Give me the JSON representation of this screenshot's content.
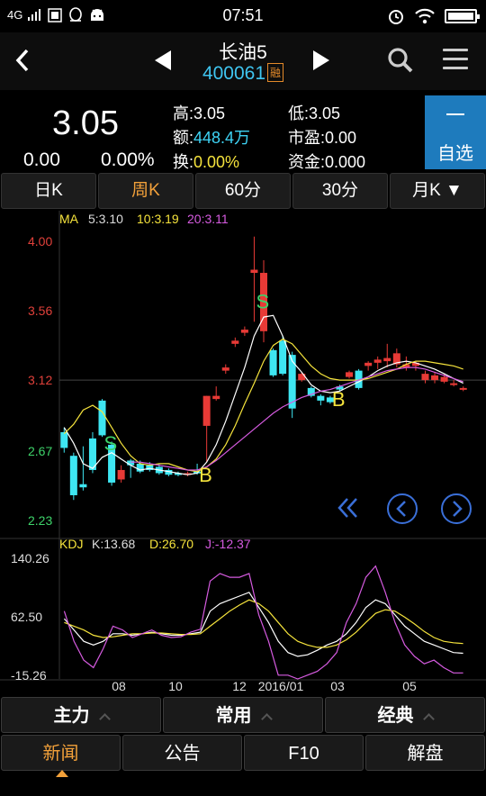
{
  "status_bar": {
    "network": "4G",
    "time": "07:51"
  },
  "header": {
    "stock_name": "长油5",
    "stock_code": "400061",
    "margin_badge": "融"
  },
  "quote": {
    "price": "3.05",
    "change": "0.00",
    "change_pct": "0.00%",
    "high_label": "高:",
    "high_value": "3.05",
    "amount_label": "额:",
    "amount_value": "448.4万",
    "turnover_label": "换:",
    "turnover_value": "0.00%",
    "low_label": "低:",
    "low_value": "3.05",
    "pe_label": "市盈:",
    "pe_value": "0.00",
    "fund_label": "资金:",
    "fund_value": "0.000",
    "favorite_label": "自选"
  },
  "period_tabs": [
    "日K",
    "周K",
    "60分",
    "30分",
    "月K ▼"
  ],
  "active_tab": 1,
  "chart_data": [
    {
      "type": "candlestick",
      "title": "MA",
      "legend": [
        {
          "label": "5:3.10",
          "color": "#ffffff"
        },
        {
          "label": "10:3.19",
          "color": "#f5e33c"
        },
        {
          "label": "20:3.11",
          "color": "#d65be0"
        }
      ],
      "y_ticks": [
        "4.00",
        "3.56",
        "3.12",
        "2.67",
        "2.23"
      ],
      "ylim": [
        2.23,
        4.0
      ],
      "x_ticks": [
        "08",
        "10",
        "12",
        "2016/01",
        "03",
        "05"
      ],
      "annotations": [
        "S",
        "B",
        "S",
        "B",
        "B"
      ],
      "candles": [
        {
          "o": 2.79,
          "c": 2.69,
          "h": 2.82,
          "l": 2.66,
          "up": false
        },
        {
          "o": 2.64,
          "c": 2.39,
          "h": 2.66,
          "l": 2.36,
          "up": false
        },
        {
          "o": 2.46,
          "c": 2.44,
          "h": 2.7,
          "l": 2.42,
          "up": false
        },
        {
          "o": 2.75,
          "c": 2.55,
          "h": 2.79,
          "l": 2.53,
          "up": false
        },
        {
          "o": 2.99,
          "c": 2.77,
          "h": 3.0,
          "l": 2.76,
          "up": false
        },
        {
          "o": 2.71,
          "c": 2.47,
          "h": 2.73,
          "l": 2.45,
          "up": false
        },
        {
          "o": 2.55,
          "c": 2.49,
          "h": 2.58,
          "l": 2.47,
          "up": true
        },
        {
          "o": 2.61,
          "c": 2.58,
          "h": 2.62,
          "l": 2.5,
          "up": false
        },
        {
          "o": 2.59,
          "c": 2.54,
          "h": 2.61,
          "l": 2.53,
          "up": false
        },
        {
          "o": 2.58,
          "c": 2.55,
          "h": 2.6,
          "l": 2.54,
          "up": false
        },
        {
          "o": 2.57,
          "c": 2.53,
          "h": 2.59,
          "l": 2.52,
          "up": false
        },
        {
          "o": 2.55,
          "c": 2.52,
          "h": 2.56,
          "l": 2.51,
          "up": false
        },
        {
          "o": 2.53,
          "c": 2.52,
          "h": 2.54,
          "l": 2.51,
          "up": false
        },
        {
          "o": 2.52,
          "c": 2.53,
          "h": 2.54,
          "l": 2.51,
          "up": true
        },
        {
          "o": 2.54,
          "c": 2.53,
          "h": 2.59,
          "l": 2.52,
          "up": false
        },
        {
          "o": 2.83,
          "c": 3.02,
          "h": 3.02,
          "l": 2.6,
          "up": true
        },
        {
          "o": 3.0,
          "c": 3.02,
          "h": 3.08,
          "l": 2.99,
          "up": true
        },
        {
          "o": 3.18,
          "c": 3.2,
          "h": 3.22,
          "l": 3.16,
          "up": true
        },
        {
          "o": 3.35,
          "c": 3.37,
          "h": 3.39,
          "l": 3.33,
          "up": true
        },
        {
          "o": 3.42,
          "c": 3.44,
          "h": 3.46,
          "l": 3.4,
          "up": true
        },
        {
          "o": 3.8,
          "c": 3.82,
          "h": 4.03,
          "l": 3.49,
          "up": true
        },
        {
          "o": 3.43,
          "c": 3.8,
          "h": 3.88,
          "l": 3.36,
          "up": true
        },
        {
          "o": 3.31,
          "c": 3.15,
          "h": 3.32,
          "l": 3.14,
          "up": false
        },
        {
          "o": 3.37,
          "c": 3.16,
          "h": 3.4,
          "l": 3.15,
          "up": false
        },
        {
          "o": 3.28,
          "c": 2.94,
          "h": 3.3,
          "l": 2.88,
          "up": false
        },
        {
          "o": 3.16,
          "c": 3.12,
          "h": 3.17,
          "l": 3.11,
          "up": true
        },
        {
          "o": 3.07,
          "c": 3.02,
          "h": 3.08,
          "l": 3.01,
          "up": false
        },
        {
          "o": 3.02,
          "c": 2.99,
          "h": 3.03,
          "l": 2.96,
          "up": false
        },
        {
          "o": 3.01,
          "c": 2.98,
          "h": 3.02,
          "l": 2.97,
          "up": false
        },
        {
          "o": 3.08,
          "c": 3.06,
          "h": 3.09,
          "l": 3.05,
          "up": false
        },
        {
          "o": 3.14,
          "c": 3.17,
          "h": 3.18,
          "l": 3.13,
          "up": true
        },
        {
          "o": 3.18,
          "c": 3.07,
          "h": 3.19,
          "l": 3.06,
          "up": false
        },
        {
          "o": 3.21,
          "c": 3.23,
          "h": 3.24,
          "l": 3.18,
          "up": true
        },
        {
          "o": 3.23,
          "c": 3.25,
          "h": 3.27,
          "l": 3.19,
          "up": true
        },
        {
          "o": 3.24,
          "c": 3.26,
          "h": 3.35,
          "l": 3.2,
          "up": true
        },
        {
          "o": 3.22,
          "c": 3.29,
          "h": 3.32,
          "l": 3.2,
          "up": true
        },
        {
          "o": 3.2,
          "c": 3.22,
          "h": 3.27,
          "l": 3.18,
          "up": true
        },
        {
          "o": 3.21,
          "c": 3.23,
          "h": 3.24,
          "l": 3.18,
          "up": true
        },
        {
          "o": 3.12,
          "c": 3.16,
          "h": 3.18,
          "l": 3.1,
          "up": true
        },
        {
          "o": 3.12,
          "c": 3.15,
          "h": 3.17,
          "l": 3.1,
          "up": true
        },
        {
          "o": 3.11,
          "c": 3.14,
          "h": 3.16,
          "l": 3.1,
          "up": true
        },
        {
          "o": 3.09,
          "c": 3.1,
          "h": 3.12,
          "l": 3.08,
          "up": true
        },
        {
          "o": 3.06,
          "c": 3.07,
          "h": 3.08,
          "l": 3.05,
          "up": true
        }
      ],
      "ma_series": [
        {
          "name": "MA5",
          "color": "#ffffff",
          "values": [
            2.82,
            2.72,
            2.59,
            2.56,
            2.63,
            2.66,
            2.62,
            2.58,
            2.55,
            2.56,
            2.55,
            2.54,
            2.53,
            2.52,
            2.53,
            2.6,
            2.71,
            2.86,
            3.03,
            3.2,
            3.4,
            3.52,
            3.53,
            3.4,
            3.24,
            3.17,
            3.09,
            3.05,
            3.04,
            3.05,
            3.08,
            3.11,
            3.14,
            3.18,
            3.21,
            3.23,
            3.24,
            3.23,
            3.21,
            3.19,
            3.16,
            3.13,
            3.1
          ]
        },
        {
          "name": "MA10",
          "color": "#f5e33c",
          "values": [
            2.78,
            2.84,
            2.93,
            2.96,
            2.92,
            2.82,
            2.72,
            2.64,
            2.59,
            2.58,
            2.59,
            2.59,
            2.57,
            2.55,
            2.54,
            2.57,
            2.62,
            2.71,
            2.83,
            2.97,
            3.1,
            3.24,
            3.34,
            3.38,
            3.35,
            3.28,
            3.21,
            3.16,
            3.13,
            3.12,
            3.12,
            3.12,
            3.13,
            3.15,
            3.17,
            3.19,
            3.22,
            3.24,
            3.24,
            3.23,
            3.22,
            3.21,
            3.19
          ]
        },
        {
          "name": "MA20",
          "color": "#d65be0",
          "values": [
            null,
            null,
            null,
            null,
            null,
            null,
            null,
            2.6,
            2.6,
            2.59,
            2.58,
            2.57,
            2.56,
            2.55,
            2.55,
            2.57,
            2.61,
            2.66,
            2.71,
            2.76,
            2.81,
            2.86,
            2.91,
            2.95,
            2.98,
            3.01,
            3.03,
            3.05,
            3.06,
            3.08,
            3.1,
            3.12,
            3.14,
            3.16,
            3.18,
            3.19,
            3.2,
            3.2,
            3.19,
            3.17,
            3.15,
            3.13,
            3.11
          ]
        }
      ]
    },
    {
      "type": "line",
      "title": "KDJ",
      "legend": [
        {
          "label": "K:13.68",
          "color": "#ffffff"
        },
        {
          "label": "D:26.70",
          "color": "#f5e33c"
        },
        {
          "label": "J:-12.37",
          "color": "#d65be0"
        }
      ],
      "y_ticks": [
        "140.26",
        "62.50",
        "-15.26"
      ],
      "ylim": [
        -15.26,
        140.26
      ],
      "series": [
        {
          "name": "K",
          "color": "#ffffff",
          "values": [
            60,
            45,
            30,
            25,
            30,
            40,
            40,
            38,
            40,
            42,
            40,
            38,
            38,
            40,
            42,
            70,
            80,
            85,
            90,
            95,
            75,
            55,
            30,
            15,
            10,
            12,
            18,
            25,
            30,
            40,
            55,
            75,
            85,
            80,
            65,
            50,
            40,
            30,
            25,
            20,
            15,
            14
          ]
        },
        {
          "name": "D",
          "color": "#f5e33c",
          "values": [
            55,
            50,
            45,
            38,
            35,
            36,
            38,
            40,
            40,
            41,
            41,
            40,
            39,
            39,
            40,
            50,
            60,
            70,
            78,
            85,
            80,
            70,
            55,
            40,
            30,
            25,
            22,
            22,
            25,
            32,
            42,
            55,
            67,
            72,
            70,
            62,
            53,
            43,
            35,
            30,
            28,
            27
          ]
        },
        {
          "name": "J",
          "color": "#d65be0",
          "values": [
            70,
            30,
            5,
            -5,
            20,
            50,
            45,
            35,
            40,
            45,
            38,
            35,
            36,
            42,
            46,
            110,
            120,
            115,
            115,
            120,
            65,
            30,
            -15,
            -15,
            -20,
            -15,
            -10,
            0,
            15,
            55,
            80,
            115,
            130,
            95,
            55,
            25,
            10,
            0,
            5,
            -5,
            -12,
            -12
          ]
        }
      ]
    }
  ],
  "bottom_groups": [
    "主力",
    "常用",
    "经典"
  ],
  "bottom_tabs": [
    "新闻",
    "公告",
    "F10",
    "解盘"
  ],
  "active_bottom_tab": 0
}
